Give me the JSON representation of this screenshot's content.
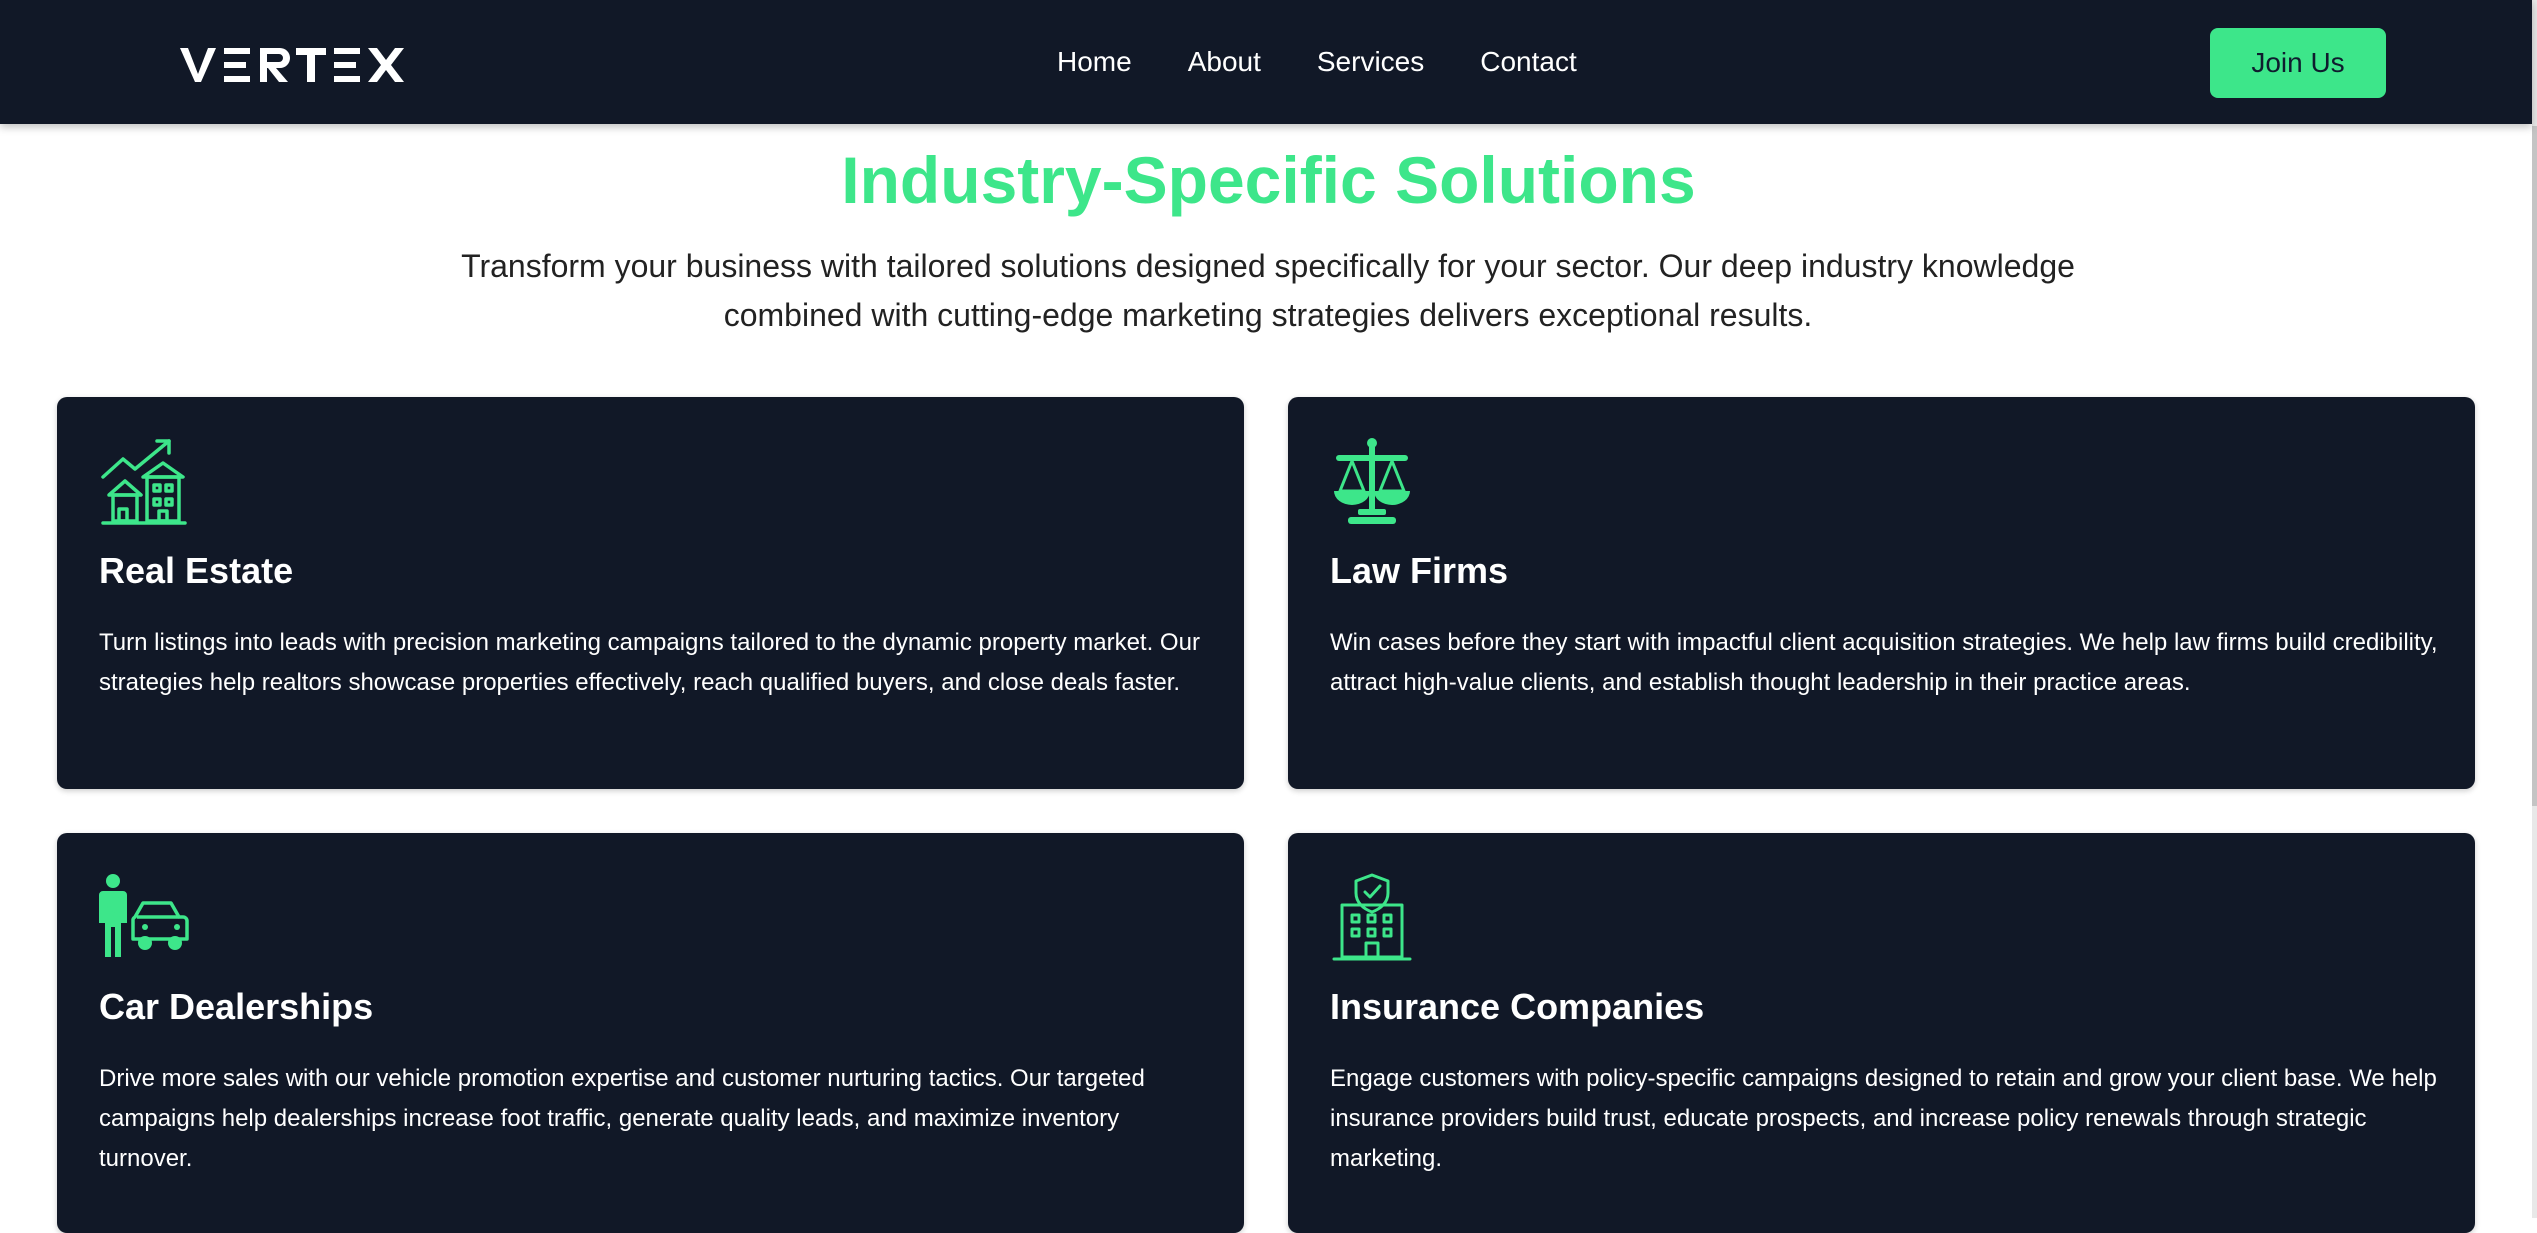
{
  "header": {
    "logo_text": "VERTEX",
    "nav": [
      {
        "label": "Home"
      },
      {
        "label": "About"
      },
      {
        "label": "Services"
      },
      {
        "label": "Contact"
      }
    ],
    "cta_label": "Join Us"
  },
  "section": {
    "title": "Industry-Specific Solutions",
    "subtitle": "Transform your business with tailored solutions designed specifically for your sector. Our deep industry knowledge combined with cutting-edge marketing strategies delivers exceptional results."
  },
  "cards": [
    {
      "icon": "house-growth-icon",
      "title": "Real Estate",
      "description": "Turn listings into leads with precision marketing campaigns tailored to the dynamic property market. Our strategies help realtors showcase properties effectively, reach qualified buyers, and close deals faster."
    },
    {
      "icon": "scales-icon",
      "title": "Law Firms",
      "description": "Win cases before they start with impactful client acquisition strategies. We help law firms build credibility, attract high-value clients, and establish thought leadership in their practice areas."
    },
    {
      "icon": "car-dealer-icon",
      "title": "Car Dealerships",
      "description": "Drive more sales with our vehicle promotion expertise and customer nurturing tactics. Our targeted campaigns help dealerships increase foot traffic, generate quality leads, and maximize inventory turnover."
    },
    {
      "icon": "insurance-building-icon",
      "title": "Insurance Companies",
      "description": "Engage customers with policy-specific campaigns designed to retain and grow your client base. We help insurance providers build trust, educate prospects, and increase policy renewals through strategic marketing."
    }
  ],
  "colors": {
    "accent": "#3de68a",
    "nav_bg": "#111827",
    "card_bg": "#111827",
    "text_dark": "#222222"
  }
}
